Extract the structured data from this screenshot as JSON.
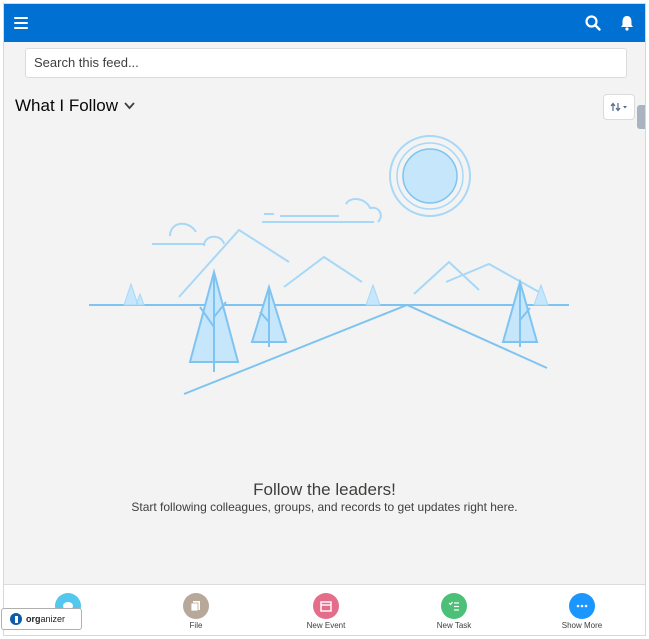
{
  "header": {
    "menu_icon": "hamburger-icon",
    "search_icon": "search-icon",
    "notifications_icon": "bell-icon",
    "bg_color": "#0070d2"
  },
  "search": {
    "placeholder": "Search this feed..."
  },
  "feed": {
    "title": "What I Follow",
    "sort_icon": "sort-arrows-icon"
  },
  "empty_state": {
    "title": "Follow the leaders!",
    "subtitle": "Start following colleagues, groups, and records to get updates right here."
  },
  "actions": [
    {
      "label": "",
      "icon": "post-icon",
      "color": "#54c7ec"
    },
    {
      "label": "File",
      "icon": "file-icon",
      "color": "#b8a89a"
    },
    {
      "label": "New Event",
      "icon": "calendar-icon",
      "color": "#e46d8c"
    },
    {
      "label": "New Task",
      "icon": "task-icon",
      "color": "#4bc076"
    },
    {
      "label": "Show More",
      "icon": "more-icon",
      "color": "#1b96ff"
    }
  ],
  "organizer": {
    "brand_bold": "org",
    "brand_rest": "anizer"
  }
}
